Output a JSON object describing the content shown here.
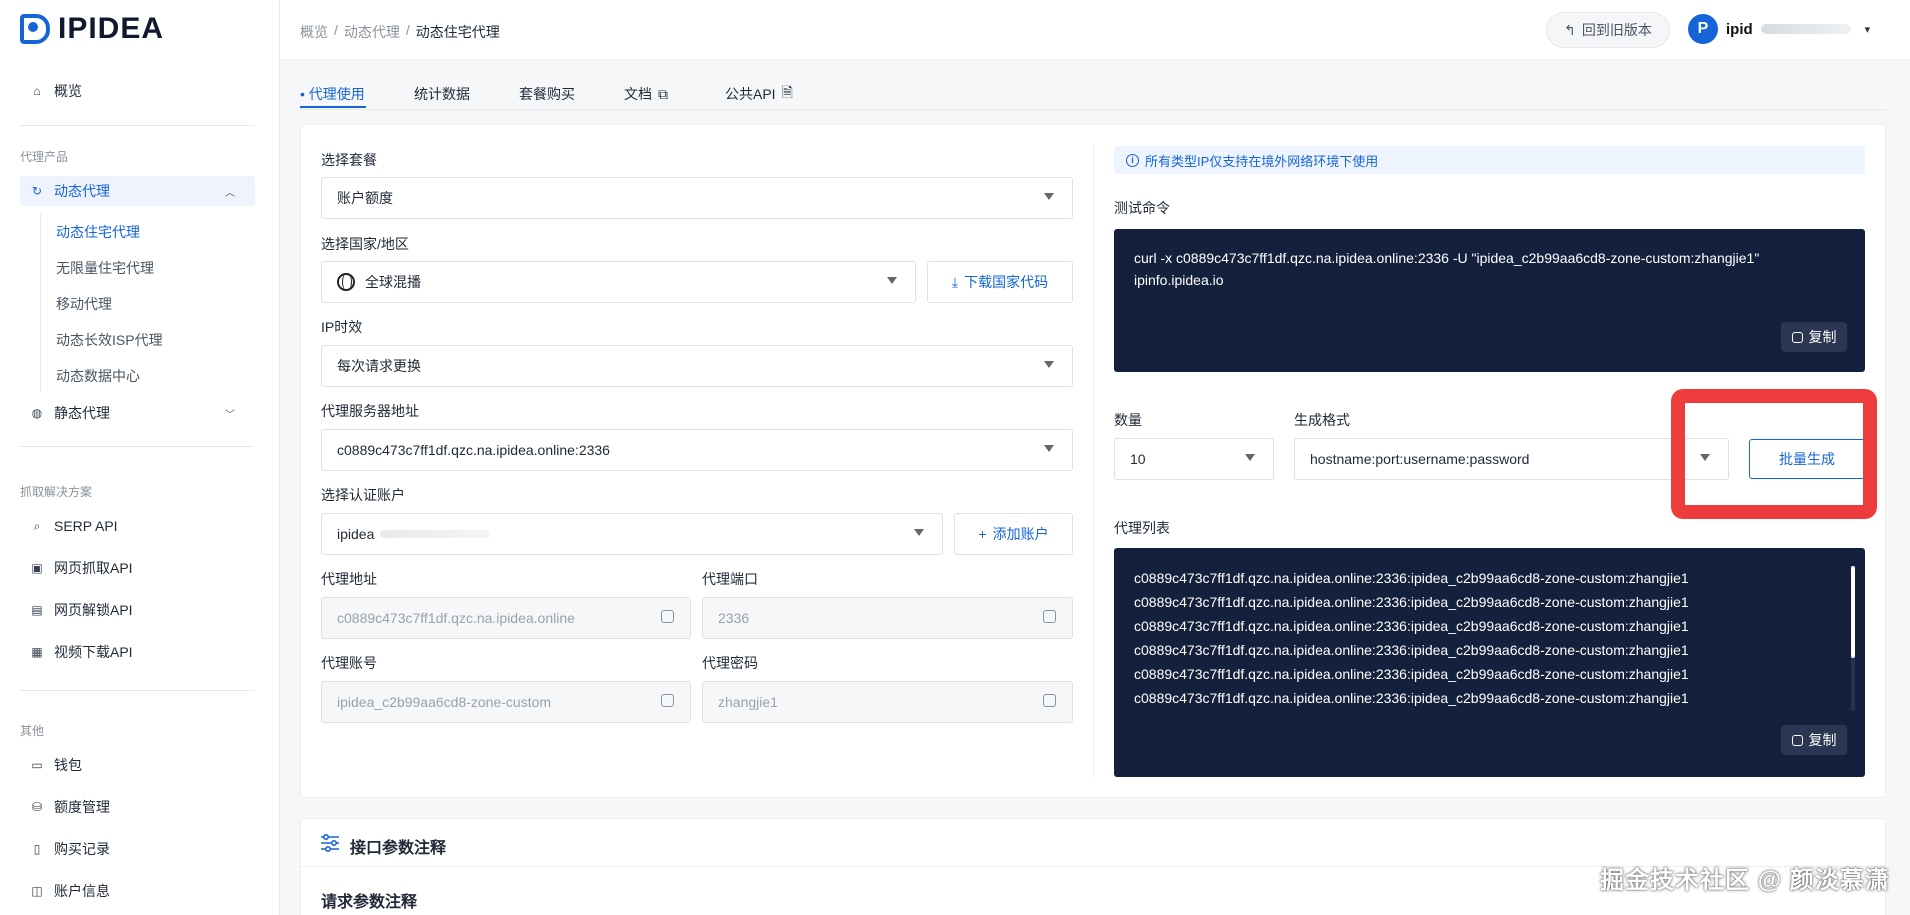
{
  "app": {
    "logo_text": "IPIDEA"
  },
  "sidebar": {
    "overview": "概览",
    "section_products": "代理产品",
    "dynamic_proxy": "动态代理",
    "dynamic_subitems": [
      "动态住宅代理",
      "无限量住宅代理",
      "移动代理",
      "动态长效ISP代理",
      "动态数据中心"
    ],
    "static_proxy": "静态代理",
    "section_scraping": "抓取解决方案",
    "scraping_items": [
      "SERP API",
      "网页抓取API",
      "网页解锁API",
      "视频下载API"
    ],
    "section_other": "其他",
    "other_items": [
      "钱包",
      "额度管理",
      "购买记录",
      "账户信息"
    ]
  },
  "header": {
    "breadcrumb": [
      "概览",
      "动态代理",
      "动态住宅代理"
    ],
    "back_button": "回到旧版本",
    "avatar_letter": "P",
    "username": "ipid"
  },
  "tabs": [
    "• 代理使用",
    "统计数据",
    "套餐购买",
    "文档",
    "公共API"
  ],
  "form": {
    "package_label": "选择套餐",
    "package_value": "账户额度",
    "region_label": "选择国家/地区",
    "region_value": "全球混播",
    "download_codes": "下载国家代码",
    "ip_duration_label": "IP时效",
    "ip_duration_value": "每次请求更换",
    "server_label": "代理服务器地址",
    "server_value": "c0889c473c7ff1df.qzc.na.ipidea.online:2336",
    "auth_label": "选择认证账户",
    "auth_value": "ipidea",
    "add_account": "添加账户",
    "addr_label": "代理地址",
    "addr_value": "c0889c473c7ff1df.qzc.na.ipidea.online",
    "port_label": "代理端口",
    "port_value": "2336",
    "user_label": "代理账号",
    "user_value": "ipidea_c2b99aa6cd8-zone-custom",
    "pass_label": "代理密码",
    "pass_value": "zhangjie1"
  },
  "right": {
    "notice": "所有类型IP仅支持在境外网络环境下使用",
    "test_label": "测试命令",
    "test_command": "curl -x c0889c473c7ff1df.qzc.na.ipidea.online:2336 -U \"ipidea_c2b99aa6cd8-zone-custom:zhangjie1\" ipinfo.ipidea.io",
    "copy": "复制",
    "qty_label": "数量",
    "qty_value": "10",
    "format_label": "生成格式",
    "format_value": "hostname:port:username:password",
    "generate": "批量生成",
    "list_label": "代理列表",
    "proxy_list": [
      "c0889c473c7ff1df.qzc.na.ipidea.online:2336:ipidea_c2b99aa6cd8-zone-custom:zhangjie1",
      "c0889c473c7ff1df.qzc.na.ipidea.online:2336:ipidea_c2b99aa6cd8-zone-custom:zhangjie1",
      "c0889c473c7ff1df.qzc.na.ipidea.online:2336:ipidea_c2b99aa6cd8-zone-custom:zhangjie1",
      "c0889c473c7ff1df.qzc.na.ipidea.online:2336:ipidea_c2b99aa6cd8-zone-custom:zhangjie1",
      "c0889c473c7ff1df.qzc.na.ipidea.online:2336:ipidea_c2b99aa6cd8-zone-custom:zhangjie1",
      "c0889c473c7ff1df.qzc.na.ipidea.online:2336:ipidea_c2b99aa6cd8-zone-custom:zhangjie1"
    ]
  },
  "bottom": {
    "title": "接口参数注释",
    "subtitle": "请求参数注释"
  },
  "watermark": "掘金技术社区 @ 颜淡慕潇",
  "colors": {
    "accent": "#1565d8",
    "code_bg": "#14213d",
    "highlight": "#ee3b3b"
  }
}
